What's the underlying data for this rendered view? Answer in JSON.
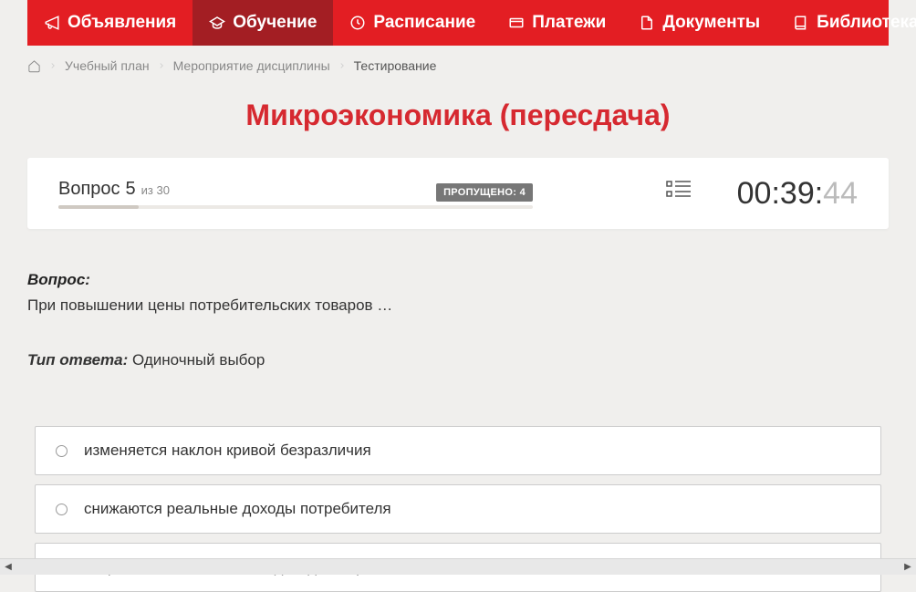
{
  "nav": {
    "items": [
      {
        "label": "Объявления"
      },
      {
        "label": "Обучение"
      },
      {
        "label": "Расписание"
      },
      {
        "label": "Платежи"
      },
      {
        "label": "Документы"
      },
      {
        "label": "Библиотека"
      }
    ]
  },
  "breadcrumb": {
    "items": [
      "Учебный план",
      "Мероприятие дисциплины",
      "Тестирование"
    ]
  },
  "page_title": "Микроэкономика (пересдача)",
  "progress": {
    "question_word": "Вопрос",
    "current": "5",
    "total_prefix": "из",
    "total": "30",
    "skipped_label": "ПРОПУЩЕНО:",
    "skipped_count": "4"
  },
  "timer": {
    "main": "00:39:",
    "seconds": "44"
  },
  "question": {
    "label": "Вопрос:",
    "text": "При повышении цены потребительских товаров …",
    "answer_type_label": "Тип ответа:",
    "answer_type": "Одиночный выбор"
  },
  "options": [
    "изменяется наклон кривой безразличия",
    "снижаются реальные доходы потребителя",
    "возрастают номинальные доходы потребителя"
  ]
}
